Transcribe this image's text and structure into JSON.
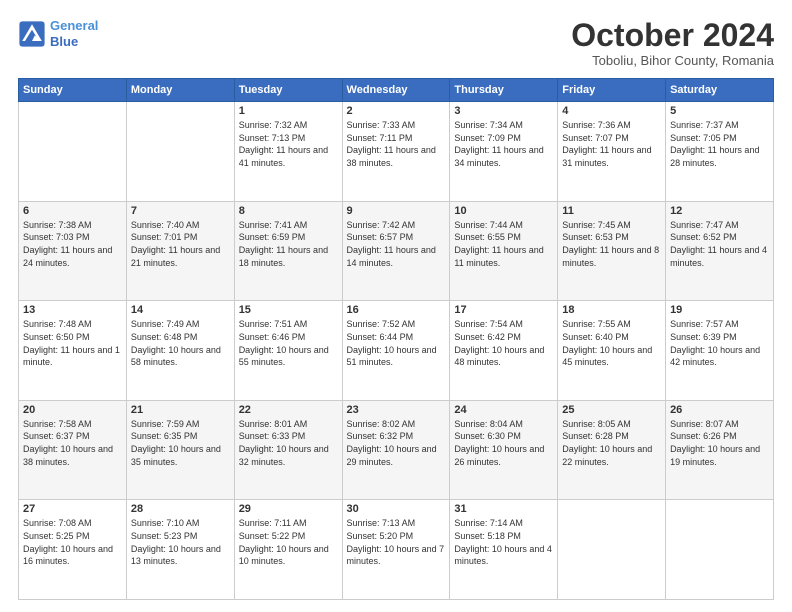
{
  "header": {
    "logo_line1": "General",
    "logo_line2": "Blue",
    "month": "October 2024",
    "location": "Toboliu, Bihor County, Romania"
  },
  "weekdays": [
    "Sunday",
    "Monday",
    "Tuesday",
    "Wednesday",
    "Thursday",
    "Friday",
    "Saturday"
  ],
  "weeks": [
    [
      {
        "day": "",
        "info": ""
      },
      {
        "day": "",
        "info": ""
      },
      {
        "day": "1",
        "info": "Sunrise: 7:32 AM\nSunset: 7:13 PM\nDaylight: 11 hours and 41 minutes."
      },
      {
        "day": "2",
        "info": "Sunrise: 7:33 AM\nSunset: 7:11 PM\nDaylight: 11 hours and 38 minutes."
      },
      {
        "day": "3",
        "info": "Sunrise: 7:34 AM\nSunset: 7:09 PM\nDaylight: 11 hours and 34 minutes."
      },
      {
        "day": "4",
        "info": "Sunrise: 7:36 AM\nSunset: 7:07 PM\nDaylight: 11 hours and 31 minutes."
      },
      {
        "day": "5",
        "info": "Sunrise: 7:37 AM\nSunset: 7:05 PM\nDaylight: 11 hours and 28 minutes."
      }
    ],
    [
      {
        "day": "6",
        "info": "Sunrise: 7:38 AM\nSunset: 7:03 PM\nDaylight: 11 hours and 24 minutes."
      },
      {
        "day": "7",
        "info": "Sunrise: 7:40 AM\nSunset: 7:01 PM\nDaylight: 11 hours and 21 minutes."
      },
      {
        "day": "8",
        "info": "Sunrise: 7:41 AM\nSunset: 6:59 PM\nDaylight: 11 hours and 18 minutes."
      },
      {
        "day": "9",
        "info": "Sunrise: 7:42 AM\nSunset: 6:57 PM\nDaylight: 11 hours and 14 minutes."
      },
      {
        "day": "10",
        "info": "Sunrise: 7:44 AM\nSunset: 6:55 PM\nDaylight: 11 hours and 11 minutes."
      },
      {
        "day": "11",
        "info": "Sunrise: 7:45 AM\nSunset: 6:53 PM\nDaylight: 11 hours and 8 minutes."
      },
      {
        "day": "12",
        "info": "Sunrise: 7:47 AM\nSunset: 6:52 PM\nDaylight: 11 hours and 4 minutes."
      }
    ],
    [
      {
        "day": "13",
        "info": "Sunrise: 7:48 AM\nSunset: 6:50 PM\nDaylight: 11 hours and 1 minute."
      },
      {
        "day": "14",
        "info": "Sunrise: 7:49 AM\nSunset: 6:48 PM\nDaylight: 10 hours and 58 minutes."
      },
      {
        "day": "15",
        "info": "Sunrise: 7:51 AM\nSunset: 6:46 PM\nDaylight: 10 hours and 55 minutes."
      },
      {
        "day": "16",
        "info": "Sunrise: 7:52 AM\nSunset: 6:44 PM\nDaylight: 10 hours and 51 minutes."
      },
      {
        "day": "17",
        "info": "Sunrise: 7:54 AM\nSunset: 6:42 PM\nDaylight: 10 hours and 48 minutes."
      },
      {
        "day": "18",
        "info": "Sunrise: 7:55 AM\nSunset: 6:40 PM\nDaylight: 10 hours and 45 minutes."
      },
      {
        "day": "19",
        "info": "Sunrise: 7:57 AM\nSunset: 6:39 PM\nDaylight: 10 hours and 42 minutes."
      }
    ],
    [
      {
        "day": "20",
        "info": "Sunrise: 7:58 AM\nSunset: 6:37 PM\nDaylight: 10 hours and 38 minutes."
      },
      {
        "day": "21",
        "info": "Sunrise: 7:59 AM\nSunset: 6:35 PM\nDaylight: 10 hours and 35 minutes."
      },
      {
        "day": "22",
        "info": "Sunrise: 8:01 AM\nSunset: 6:33 PM\nDaylight: 10 hours and 32 minutes."
      },
      {
        "day": "23",
        "info": "Sunrise: 8:02 AM\nSunset: 6:32 PM\nDaylight: 10 hours and 29 minutes."
      },
      {
        "day": "24",
        "info": "Sunrise: 8:04 AM\nSunset: 6:30 PM\nDaylight: 10 hours and 26 minutes."
      },
      {
        "day": "25",
        "info": "Sunrise: 8:05 AM\nSunset: 6:28 PM\nDaylight: 10 hours and 22 minutes."
      },
      {
        "day": "26",
        "info": "Sunrise: 8:07 AM\nSunset: 6:26 PM\nDaylight: 10 hours and 19 minutes."
      }
    ],
    [
      {
        "day": "27",
        "info": "Sunrise: 7:08 AM\nSunset: 5:25 PM\nDaylight: 10 hours and 16 minutes."
      },
      {
        "day": "28",
        "info": "Sunrise: 7:10 AM\nSunset: 5:23 PM\nDaylight: 10 hours and 13 minutes."
      },
      {
        "day": "29",
        "info": "Sunrise: 7:11 AM\nSunset: 5:22 PM\nDaylight: 10 hours and 10 minutes."
      },
      {
        "day": "30",
        "info": "Sunrise: 7:13 AM\nSunset: 5:20 PM\nDaylight: 10 hours and 7 minutes."
      },
      {
        "day": "31",
        "info": "Sunrise: 7:14 AM\nSunset: 5:18 PM\nDaylight: 10 hours and 4 minutes."
      },
      {
        "day": "",
        "info": ""
      },
      {
        "day": "",
        "info": ""
      }
    ]
  ]
}
